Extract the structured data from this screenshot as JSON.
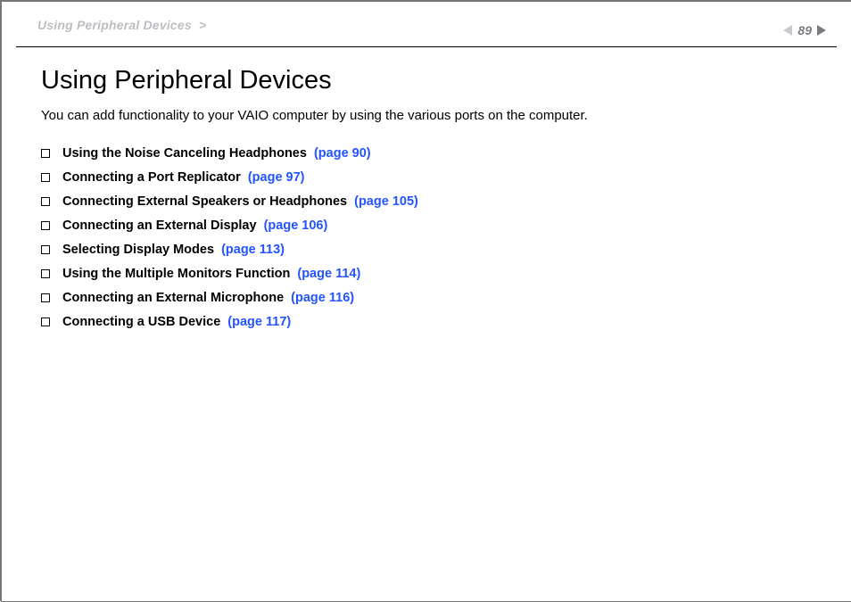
{
  "header": {
    "breadcrumb": "Using Peripheral Devices",
    "breadcrumb_sep": ">",
    "page_number": "89"
  },
  "main": {
    "title": "Using Peripheral Devices",
    "intro": "You can add functionality to your VAIO computer by using the various ports on the computer.",
    "toc": [
      {
        "label": "Using the Noise Canceling Headphones",
        "page": "(page 90)"
      },
      {
        "label": "Connecting a Port Replicator",
        "page": "(page 97)"
      },
      {
        "label": "Connecting External Speakers or Headphones",
        "page": "(page 105)"
      },
      {
        "label": "Connecting an External Display",
        "page": "(page 106)"
      },
      {
        "label": "Selecting Display Modes",
        "page": "(page 113)"
      },
      {
        "label": "Using the Multiple Monitors Function",
        "page": "(page 114)"
      },
      {
        "label": "Connecting an External Microphone",
        "page": "(page 116)"
      },
      {
        "label": "Connecting a USB Device",
        "page": "(page 117)"
      }
    ]
  }
}
